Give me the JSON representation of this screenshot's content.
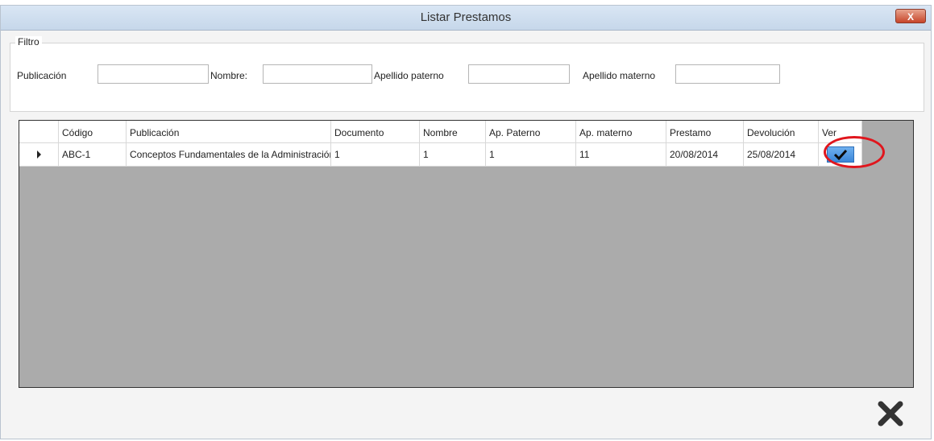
{
  "window": {
    "title": "Listar Prestamos",
    "close_label": "X"
  },
  "filter": {
    "legend": "Filtro",
    "fields": [
      {
        "label": "Publicación",
        "value": ""
      },
      {
        "label": "Nombre:",
        "value": ""
      },
      {
        "label": "Apellido paterno",
        "value": ""
      },
      {
        "label": "Apellido materno",
        "value": ""
      }
    ]
  },
  "grid": {
    "columns": [
      "Código",
      "Publicación",
      "Documento",
      "Nombre",
      "Ap. Paterno",
      "Ap. materno",
      "Prestamo",
      "Devolución",
      "Ver"
    ],
    "rows": [
      [
        "ABC-1",
        "Conceptos Fundamentales de la Administración",
        "1",
        "1",
        "1",
        "11",
        "20/08/2014",
        "25/08/2014"
      ]
    ]
  },
  "icons": {
    "row_indicator": "arrow-right-icon",
    "ver": "checkmark-icon",
    "close": "close-x-icon"
  },
  "colors": {
    "title_bg": "#c6d7ea",
    "grid_bg": "#ababab",
    "check_bg": "#3b86d8",
    "highlight": "#e0161d"
  }
}
